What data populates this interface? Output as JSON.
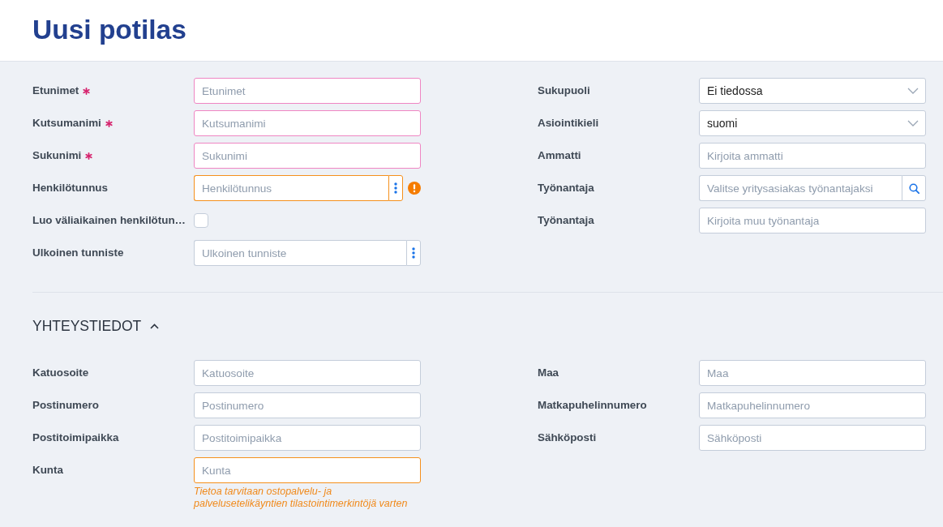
{
  "page": {
    "title": "Uusi potilas"
  },
  "basic_info": {
    "left_fields": [
      {
        "kind": "text",
        "label": "Etunimet",
        "required": true,
        "error": true,
        "warning": false,
        "alert": false,
        "placeholder": "Etunimet"
      },
      {
        "kind": "text",
        "label": "Kutsumanimi",
        "required": true,
        "error": true,
        "warning": false,
        "alert": false,
        "placeholder": "Kutsumanimi"
      },
      {
        "kind": "text",
        "label": "Sukunimi",
        "required": true,
        "error": true,
        "warning": false,
        "alert": false,
        "placeholder": "Sukunimi"
      },
      {
        "kind": "text-menu",
        "label": "Henkilötunnus",
        "required": false,
        "error": false,
        "warning": true,
        "alert": true,
        "placeholder": "Henkilötunnus"
      },
      {
        "kind": "checkbox",
        "label": "Luo väliaikainen henkilötun…",
        "required": false,
        "error": false,
        "warning": false,
        "alert": false,
        "checked": false
      },
      {
        "kind": "text-menu",
        "label": "Ulkoinen tunniste",
        "required": false,
        "error": false,
        "warning": false,
        "alert": false,
        "placeholder": "Ulkoinen tunniste"
      }
    ],
    "right_fields": [
      {
        "kind": "select",
        "label": "Sukupuoli",
        "required": false,
        "error": false,
        "warning": false,
        "alert": false,
        "value": "Ei tiedossa"
      },
      {
        "kind": "select",
        "label": "Asiointikieli",
        "required": false,
        "error": false,
        "warning": false,
        "alert": false,
        "value": "suomi"
      },
      {
        "kind": "text",
        "label": "Ammatti",
        "required": false,
        "error": false,
        "warning": false,
        "alert": false,
        "placeholder": "Kirjoita ammatti"
      },
      {
        "kind": "text-search",
        "label": "Työnantaja",
        "required": false,
        "error": false,
        "warning": false,
        "alert": false,
        "placeholder": "Valitse yritysasiakas työnantajaksi"
      },
      {
        "kind": "text",
        "label": "Työnantaja",
        "required": false,
        "error": false,
        "warning": false,
        "alert": false,
        "placeholder": "Kirjoita muu työnantaja"
      }
    ]
  },
  "contact_section": {
    "title": "YHTEYSTIEDOT",
    "expanded": true,
    "left_fields": [
      {
        "kind": "text",
        "label": "Katuosoite",
        "required": false,
        "error": false,
        "warning": false,
        "alert": false,
        "placeholder": "Katuosoite"
      },
      {
        "kind": "text",
        "label": "Postinumero",
        "required": false,
        "error": false,
        "warning": false,
        "alert": false,
        "placeholder": "Postinumero"
      },
      {
        "kind": "text",
        "label": "Postitoimipaikka",
        "required": false,
        "error": false,
        "warning": false,
        "alert": false,
        "placeholder": "Postitoimipaikka"
      },
      {
        "kind": "text",
        "label": "Kunta",
        "required": false,
        "error": false,
        "warning": true,
        "alert": false,
        "placeholder": "Kunta",
        "hint": "Tietoa tarvitaan ostopalvelu- ja palvelusetelikäyntien tilastointimerkintöjä varten"
      }
    ],
    "right_fields": [
      {
        "kind": "text",
        "label": "Maa",
        "required": false,
        "error": false,
        "warning": false,
        "alert": false,
        "placeholder": "Maa"
      },
      {
        "kind": "text",
        "label": "Matkapuhelinnumero",
        "required": false,
        "error": false,
        "warning": false,
        "alert": false,
        "placeholder": "Matkapuhelinnumero"
      },
      {
        "kind": "text",
        "label": "Sähköposti",
        "required": false,
        "error": false,
        "warning": false,
        "alert": false,
        "placeholder": "Sähköposti"
      }
    ]
  }
}
